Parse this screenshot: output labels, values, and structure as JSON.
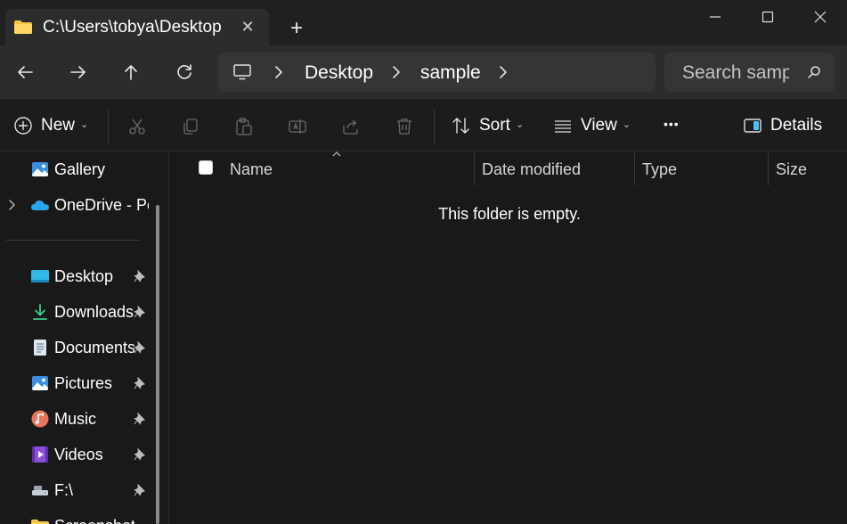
{
  "window": {
    "tab_title": "C:\\Users\\tobya\\Desktop",
    "new_tab_label": "+"
  },
  "nav": {
    "breadcrumbs": [
      "Desktop",
      "sample"
    ],
    "search_placeholder": "Search sample"
  },
  "toolbar": {
    "new_label": "New",
    "sort_label": "Sort",
    "view_label": "View",
    "more_label": "•••",
    "details_label": "Details"
  },
  "sidebar": {
    "items": [
      {
        "label": "Gallery",
        "icon": "gallery-icon"
      },
      {
        "label": "OneDrive - Personal",
        "icon": "onedrive-icon"
      },
      {
        "label": "Desktop",
        "icon": "desktop-icon",
        "pinned": true
      },
      {
        "label": "Downloads",
        "icon": "download-icon",
        "pinned": true
      },
      {
        "label": "Documents",
        "icon": "document-icon",
        "pinned": true
      },
      {
        "label": "Pictures",
        "icon": "pictures-icon",
        "pinned": true
      },
      {
        "label": "Music",
        "icon": "music-icon",
        "pinned": true
      },
      {
        "label": "Videos",
        "icon": "videos-icon",
        "pinned": true
      },
      {
        "label": "F:\\",
        "icon": "drive-icon",
        "pinned": true
      },
      {
        "label": "Screenshots",
        "icon": "folder-icon"
      }
    ]
  },
  "columns": [
    "Name",
    "Date modified",
    "Type",
    "Size"
  ],
  "content": {
    "empty_message": "This folder is empty."
  },
  "colors": {
    "background": "#191919",
    "titlebar": "#202020",
    "toolbar": "#2c2c2c",
    "accent": "#4cc2ff",
    "folder": "#f4c542"
  }
}
